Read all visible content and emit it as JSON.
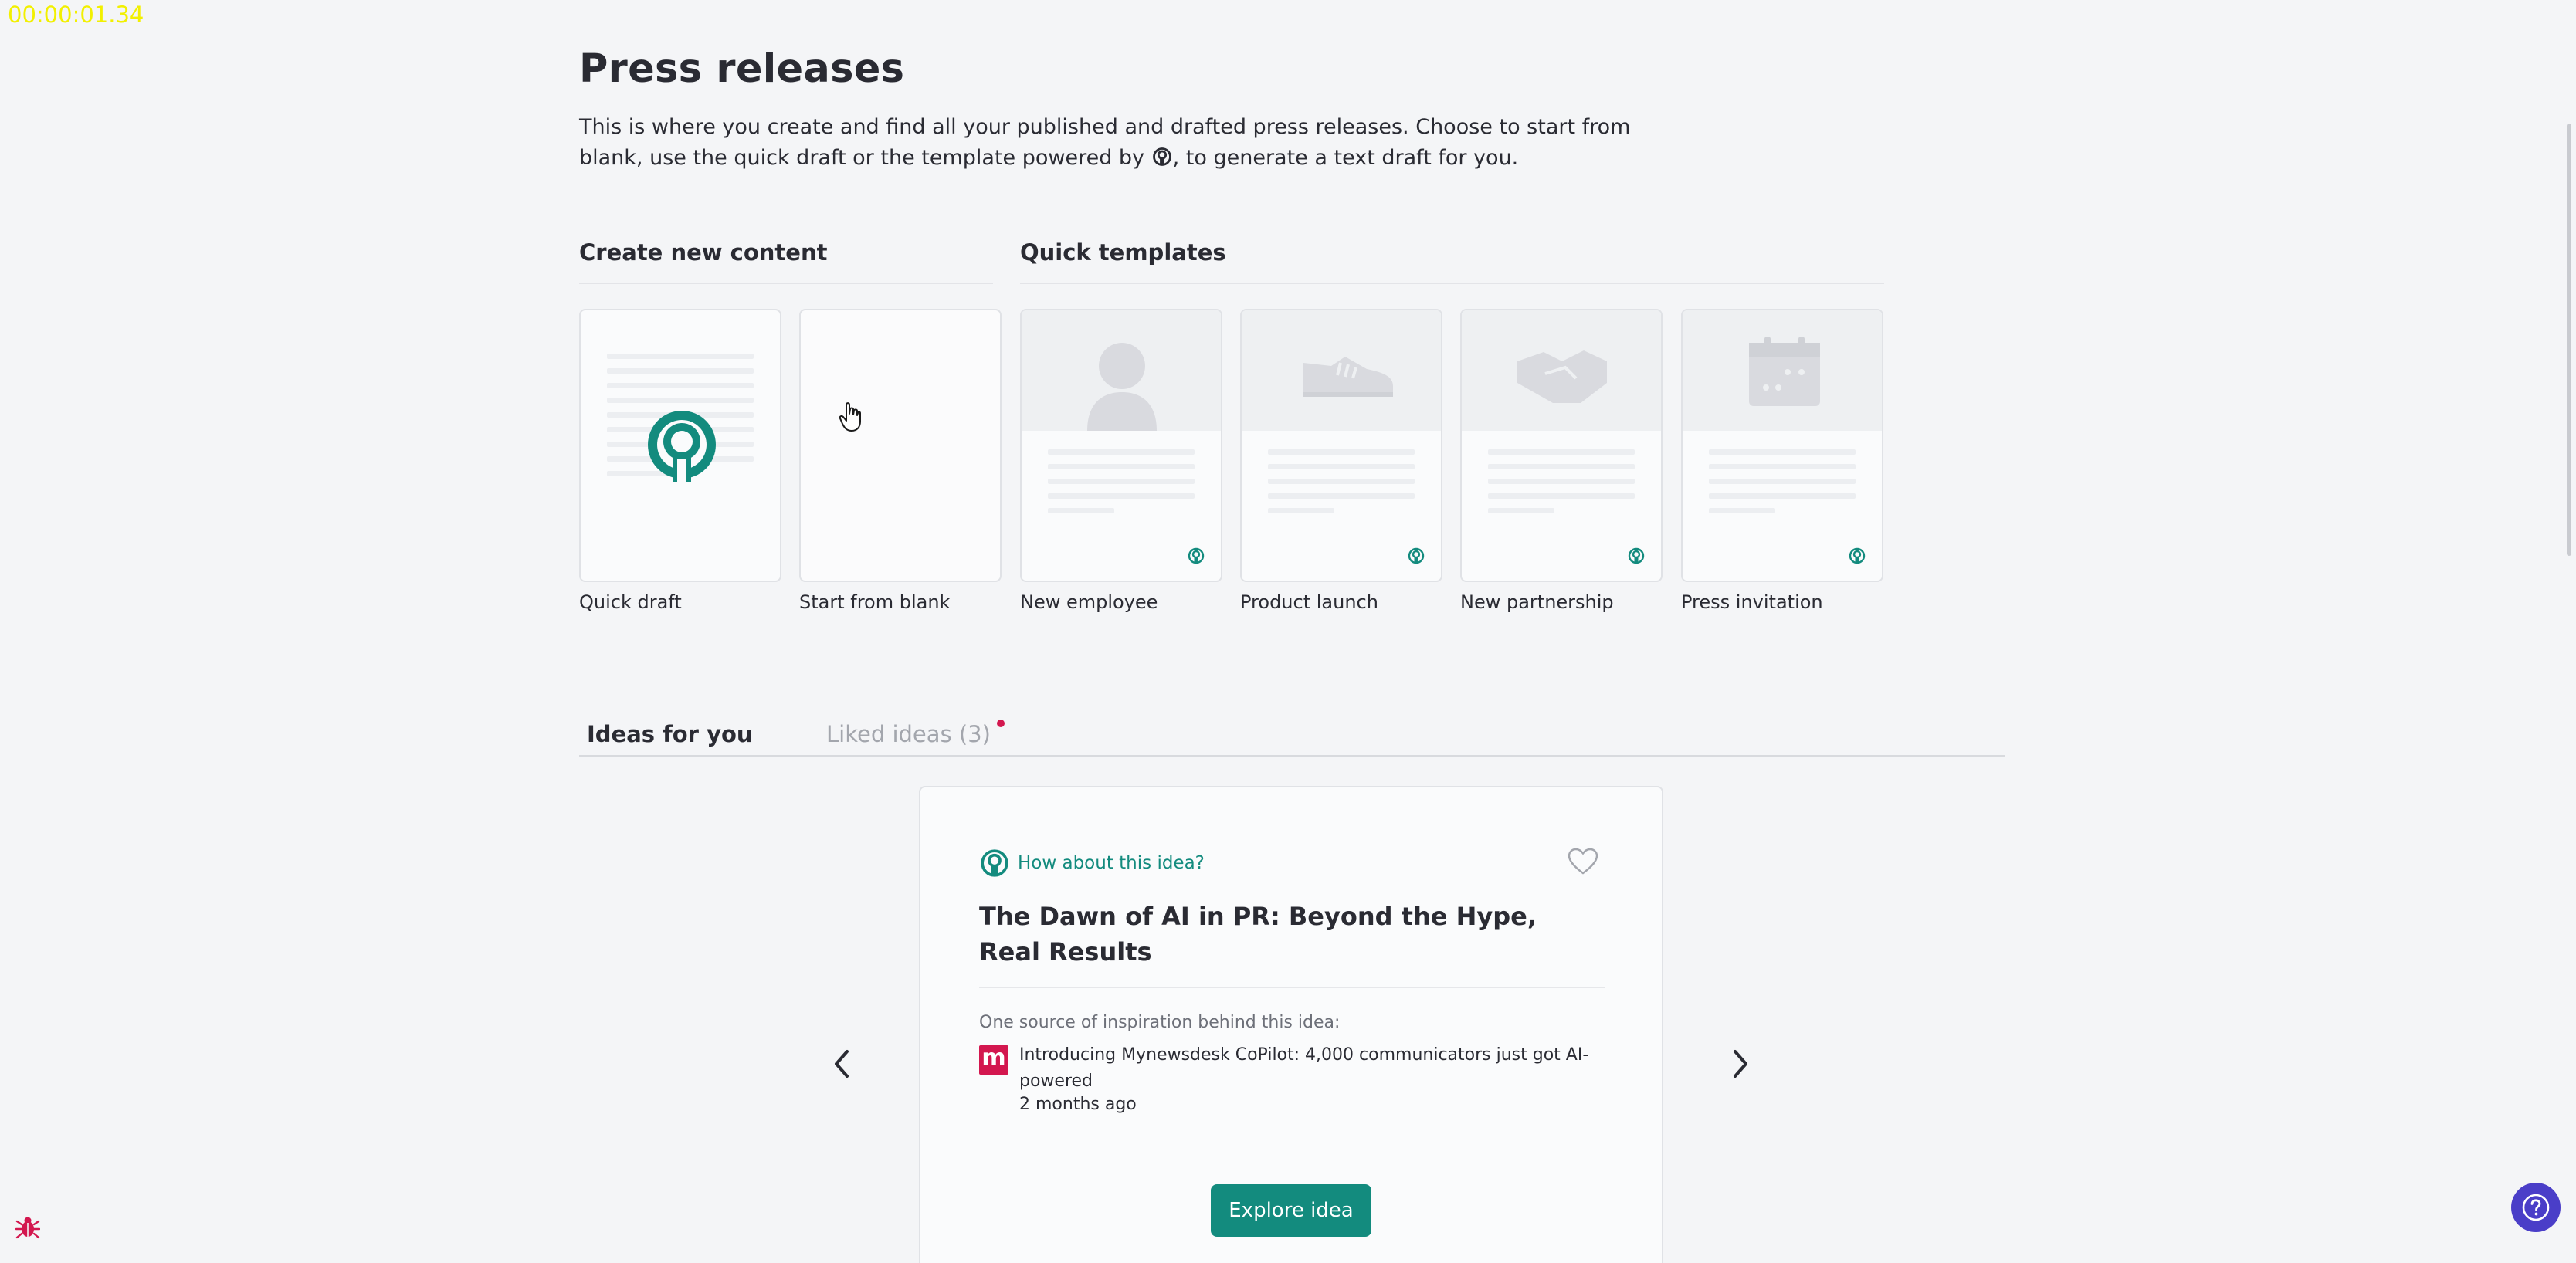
{
  "overlay": {
    "timer": "00:00:01.34"
  },
  "header": {
    "title": "Press releases",
    "intro_before_icon": "This is where you create and find all your published and drafted press releases. Choose to start from blank, use the quick draft or the template powered by ",
    "intro_after_icon": ", to generate a text draft for you."
  },
  "sections": {
    "create_new": "Create new content",
    "quick_templates": "Quick templates"
  },
  "cards": {
    "quick_draft": "Quick draft",
    "start_blank": "Start from blank",
    "new_employee": "New employee",
    "product_launch": "Product launch",
    "new_partnership": "New partnership",
    "press_invitation": "Press invitation"
  },
  "tabs": {
    "ideas_for_you": "Ideas for you",
    "liked_ideas": "Liked ideas (3)"
  },
  "idea": {
    "prompt": "How about this idea?",
    "title": "The Dawn of AI in PR: Beyond the Hype, Real Results",
    "source_label": "One source of inspiration behind this idea:",
    "source_logo": "m",
    "source_title": "Introducing Mynewsdesk CoPilot: 4,000 communicators just got AI-powered",
    "source_time": "2 months ago",
    "cta": "Explore idea"
  },
  "colors": {
    "accent": "#138b7e",
    "brand_red": "#d3174f",
    "help_purple": "#4a3ec8",
    "background": "#f4f5f7"
  },
  "icons": [
    "copilot-icon",
    "heart-icon",
    "chevron-left-icon",
    "chevron-right-icon",
    "help-icon",
    "bug-icon",
    "hand-cursor-icon"
  ]
}
